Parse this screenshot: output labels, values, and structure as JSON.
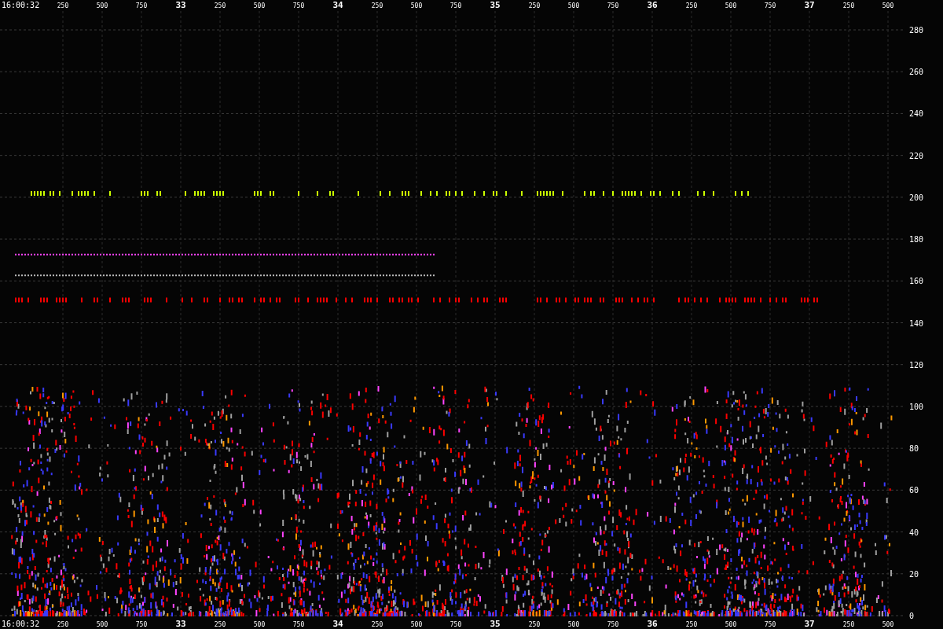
{
  "top_axis": {
    "labels": [
      {
        "text": "16:00:32",
        "kind": "time"
      },
      {
        "text": "250",
        "kind": "ms"
      },
      {
        "text": "500",
        "kind": "ms"
      },
      {
        "text": "750",
        "kind": "ms"
      },
      {
        "text": "33",
        "kind": "second"
      },
      {
        "text": "250",
        "kind": "ms"
      },
      {
        "text": "500",
        "kind": "ms"
      },
      {
        "text": "750",
        "kind": "ms"
      },
      {
        "text": "34",
        "kind": "second"
      },
      {
        "text": "250",
        "kind": "ms"
      },
      {
        "text": "500",
        "kind": "ms"
      },
      {
        "text": "750",
        "kind": "ms"
      },
      {
        "text": "35",
        "kind": "second"
      },
      {
        "text": "250",
        "kind": "ms"
      },
      {
        "text": "500",
        "kind": "ms"
      },
      {
        "text": "750",
        "kind": "ms"
      },
      {
        "text": "36",
        "kind": "second"
      },
      {
        "text": "250",
        "kind": "ms"
      },
      {
        "text": "500",
        "kind": "ms"
      },
      {
        "text": "750",
        "kind": "ms"
      },
      {
        "text": "37",
        "kind": "second"
      },
      {
        "text": "250",
        "kind": "ms"
      },
      {
        "text": "500",
        "kind": "ms"
      }
    ]
  },
  "bottom_axis": {
    "labels": [
      {
        "text": "16:00:32",
        "kind": "time"
      },
      {
        "text": "250",
        "kind": "ms"
      },
      {
        "text": "500",
        "kind": "ms"
      },
      {
        "text": "750",
        "kind": "ms"
      },
      {
        "text": "33",
        "kind": "second"
      },
      {
        "text": "250",
        "kind": "ms"
      },
      {
        "text": "500",
        "kind": "ms"
      },
      {
        "text": "750",
        "kind": "ms"
      },
      {
        "text": "34",
        "kind": "second"
      },
      {
        "text": "250",
        "kind": "ms"
      },
      {
        "text": "500",
        "kind": "ms"
      },
      {
        "text": "750",
        "kind": "ms"
      },
      {
        "text": "35",
        "kind": "second"
      },
      {
        "text": "250",
        "kind": "ms"
      },
      {
        "text": "500",
        "kind": "ms"
      },
      {
        "text": "750",
        "kind": "ms"
      },
      {
        "text": "36",
        "kind": "second"
      },
      {
        "text": "250",
        "kind": "ms"
      },
      {
        "text": "500",
        "kind": "ms"
      },
      {
        "text": "750",
        "kind": "ms"
      },
      {
        "text": "37",
        "kind": "second"
      },
      {
        "text": "250",
        "kind": "ms"
      },
      {
        "text": "500",
        "kind": "ms"
      }
    ]
  },
  "right_axis": {
    "labels": [
      "280",
      "260",
      "240",
      "220",
      "200",
      "180",
      "160",
      "140",
      "120",
      "100",
      "80",
      "60",
      "40",
      "20",
      "0"
    ]
  }
}
